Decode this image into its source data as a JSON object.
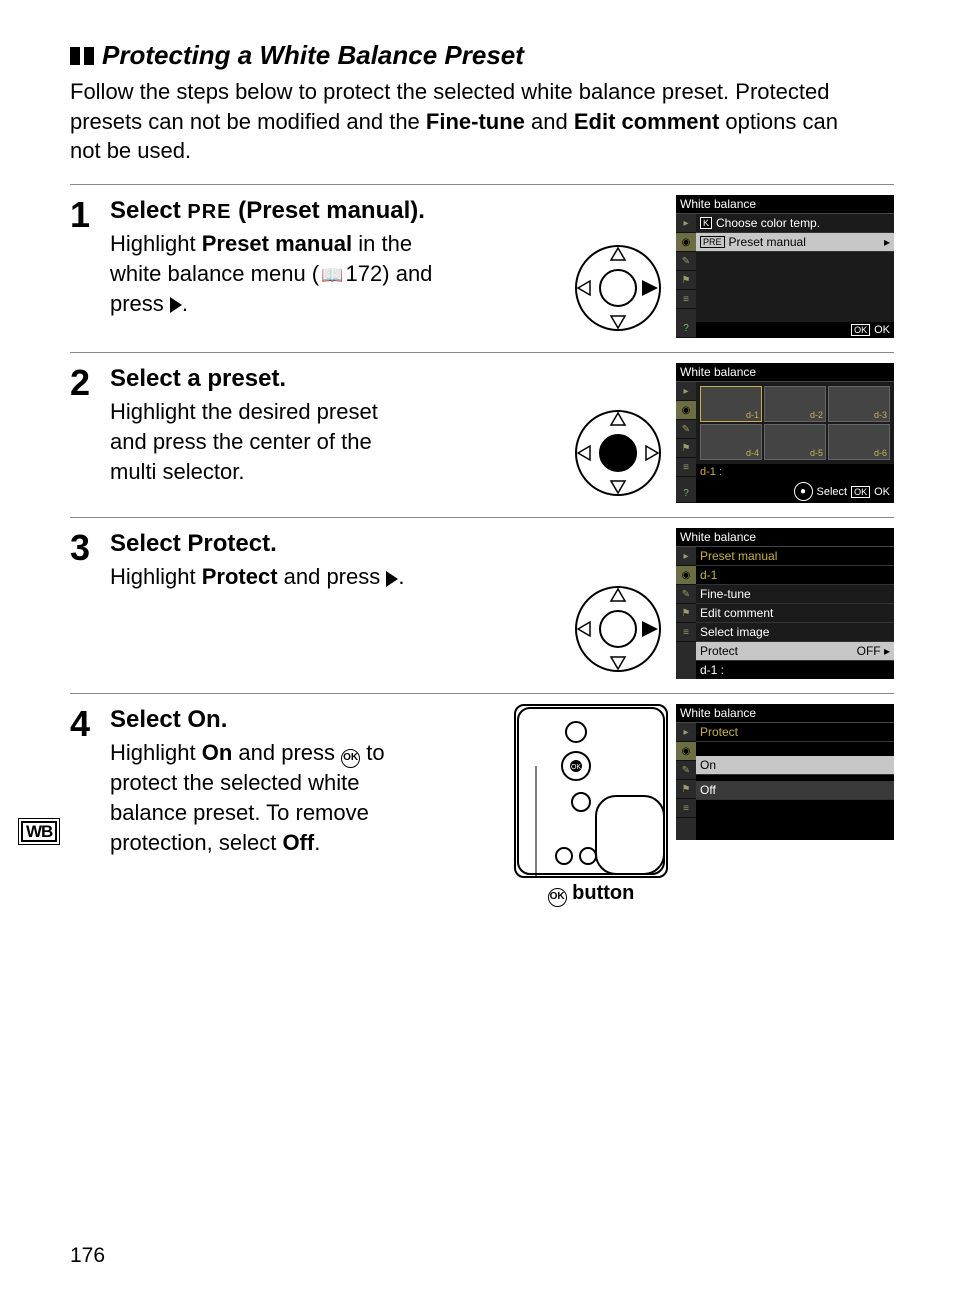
{
  "section_title": "Protecting a White Balance Preset",
  "intro": {
    "t1": "Follow the steps below to protect the selected white balance preset.  Protected presets can not be modified and the ",
    "b1": "Fine-tune",
    "t2": " and ",
    "b2": "Edit comment",
    "t3": " options can not be used."
  },
  "page_number": "176",
  "steps": {
    "s1": {
      "num": "1",
      "head_a": "Select ",
      "head_pre": "PRE",
      "head_b": " (",
      "head_c": "Preset manual",
      "head_d": ").",
      "body_a": "Highlight ",
      "body_b": "Preset manual",
      "body_c": " in the white balance menu (",
      "body_ref": "172",
      "body_d": ") and press ",
      "body_e": "."
    },
    "s2": {
      "num": "2",
      "head": "Select a preset.",
      "body": "Highlight the desired preset and press the center of the multi selector."
    },
    "s3": {
      "num": "3",
      "head_a": "Select ",
      "head_b": "Protect",
      "head_c": ".",
      "body_a": "Highlight ",
      "body_b": "Protect",
      "body_c": " and press ",
      "body_d": "."
    },
    "s4": {
      "num": "4",
      "head_a": "Select ",
      "head_b": "On",
      "head_c": ".",
      "body_a": "Highlight ",
      "body_b": "On",
      "body_c": " and press ",
      "body_d": " to protect the selected white balance preset.  To remove protection, select ",
      "body_e": "Off",
      "body_f": "."
    }
  },
  "ok_label": "OK",
  "cam_caption": " button",
  "screens": {
    "s1": {
      "title": "White balance",
      "row1_icon": "K",
      "row1_text": "Choose color temp.",
      "row2_pre": "PRE",
      "row2_text": "Preset manual",
      "ok_box": "OK",
      "ok_txt": "OK"
    },
    "s2": {
      "title": "White balance",
      "d1": "d-1",
      "d2": "d-2",
      "d3": "d-3",
      "d4": "d-4",
      "d5": "d-5",
      "d6": "d-6",
      "sub": "d-1 :",
      "sel": "Select",
      "ok_box": "OK",
      "ok_txt": "OK"
    },
    "s3": {
      "title": "White balance",
      "l1": "Preset manual",
      "l2": "d-1",
      "l3": "Fine-tune",
      "l4": "Edit comment",
      "l5": "Select image",
      "l6": "Protect",
      "l6v": "OFF",
      "sub": "d-1 :"
    },
    "s4": {
      "title": "White balance",
      "l1": "Protect",
      "on": "On",
      "off": "Off"
    }
  },
  "wb_tab": "WB"
}
